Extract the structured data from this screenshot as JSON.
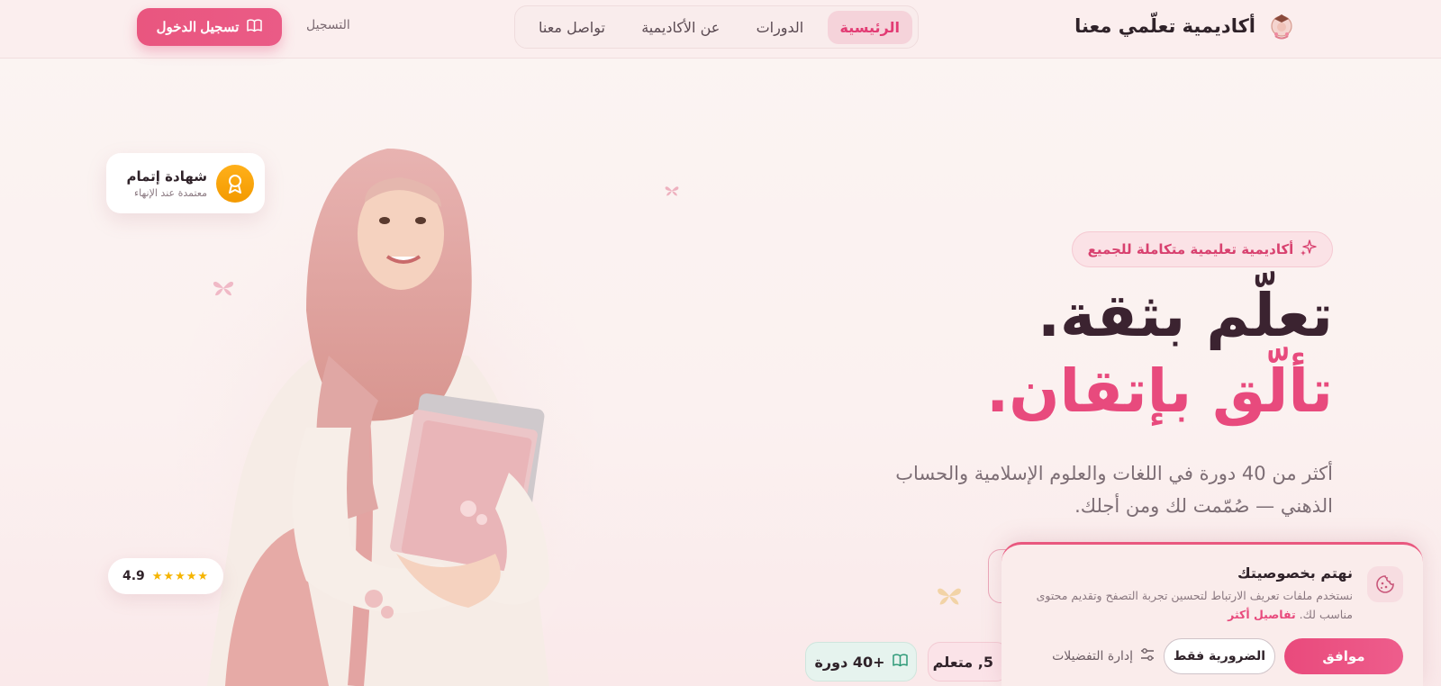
{
  "header": {
    "brand_name": "أكاديمية تعلّمي معنا",
    "nav": [
      {
        "label": "الرئيسية",
        "active": true
      },
      {
        "label": "الدورات",
        "active": false
      },
      {
        "label": "عن الأكاديمية",
        "active": false
      },
      {
        "label": "تواصل معنا",
        "active": false
      }
    ],
    "register_label": "التسجيل",
    "login_label": "تسجيل الدخول"
  },
  "hero": {
    "badge": "أكاديمية تعليمية متكاملة للجميع",
    "headline_1": "تعلّم بثقة.",
    "headline_2": "تألّق بإتقان.",
    "description": "أكثر من 40 دورة في اللغات والعلوم الإسلامية والحساب الذهني — صُمّمت لك ومن أجلك.",
    "certificate": {
      "title": "شهادة إتمام",
      "subtitle": "معتمدة عند الإنهاء"
    },
    "rating": {
      "value": "4.9",
      "stars": 5
    },
    "stats": {
      "courses": "+40 دورة",
      "learners": "5, متعلم"
    }
  },
  "cookie": {
    "title": "نهتم بخصوصيتك",
    "text": "نستخدم ملفات تعريف الارتباط لتحسين تجربة التصفح وتقديم محتوى مناسب لك.",
    "link": "تفاصيل أكثر",
    "accept": "موافق",
    "necessary": "الضرورية فقط",
    "manage": "إدارة التفضيلات"
  },
  "colors": {
    "accent": "#e84a7d",
    "dark": "#3b2330",
    "gold": "#f5b400"
  },
  "icons": [
    "academy-logo-icon",
    "book-icon",
    "sparkles-icon",
    "award-icon",
    "star-icon",
    "cookie-icon",
    "sliders-icon",
    "butterfly-icon"
  ]
}
